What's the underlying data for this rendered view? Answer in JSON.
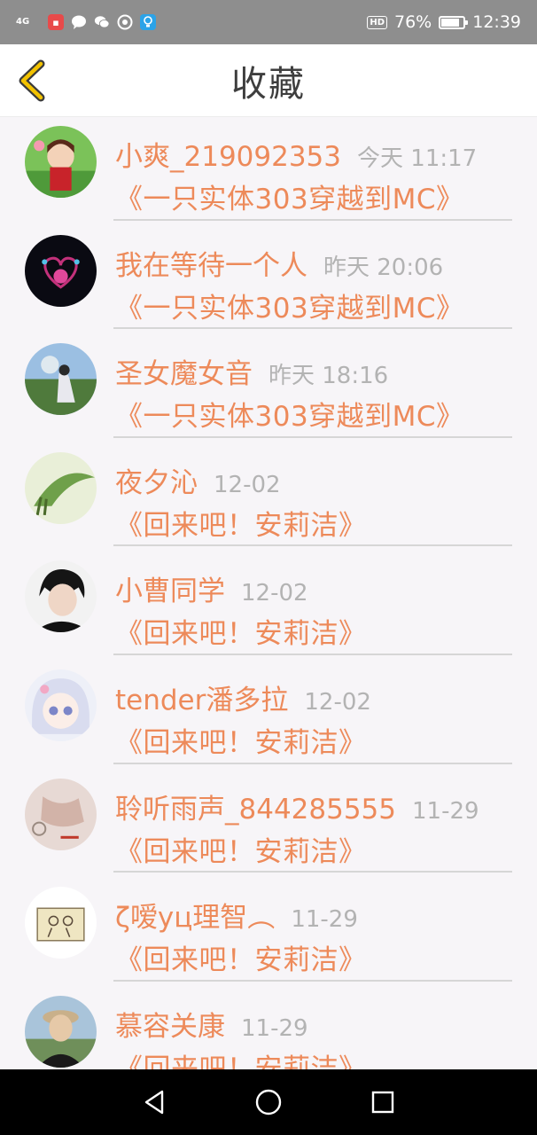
{
  "status_bar": {
    "network": "4G",
    "battery": "76%",
    "time": "12:39",
    "hd_badge": "HD",
    "icons": [
      "signal-icon",
      "app-notification-icon",
      "message-icon",
      "wechat-icon",
      "camera-app-icon",
      "bulb-icon"
    ]
  },
  "header": {
    "title": "收藏",
    "back_icon": "chevron-left-icon",
    "accent_color": "#f2c200"
  },
  "favorites": [
    {
      "name": "小爽_219092353",
      "time": "今天 11:17",
      "book": "《一只实体303穿越到MC》"
    },
    {
      "name": "我在等待一个人",
      "time": "昨天 20:06",
      "book": "《一只实体303穿越到MC》"
    },
    {
      "name": "圣女魔女音",
      "time": "昨天 18:16",
      "book": "《一只实体303穿越到MC》"
    },
    {
      "name": "夜夕沁",
      "time": "12-02",
      "book": "《回来吧！安莉洁》"
    },
    {
      "name": "小曹同学",
      "time": "12-02",
      "book": "《回来吧！安莉洁》"
    },
    {
      "name": "tender潘多拉",
      "time": "12-02",
      "book": "《回来吧！安莉洁》"
    },
    {
      "name": "聆听雨声_844285555",
      "time": "11-29",
      "book": "《回来吧！安莉洁》"
    },
    {
      "name": "ζ嗳yц理智︵",
      "time": "11-29",
      "book": "《回来吧！安莉洁》"
    },
    {
      "name": "慕容关康",
      "time": "11-29",
      "book": "《回来吧！安莉洁》"
    }
  ],
  "colors": {
    "name": "#ed8a5a",
    "time": "#b3b3b3",
    "title": "#3e3e3e"
  },
  "nav": {
    "icons": [
      "back-triangle-icon",
      "home-circle-icon",
      "recents-square-icon"
    ]
  }
}
